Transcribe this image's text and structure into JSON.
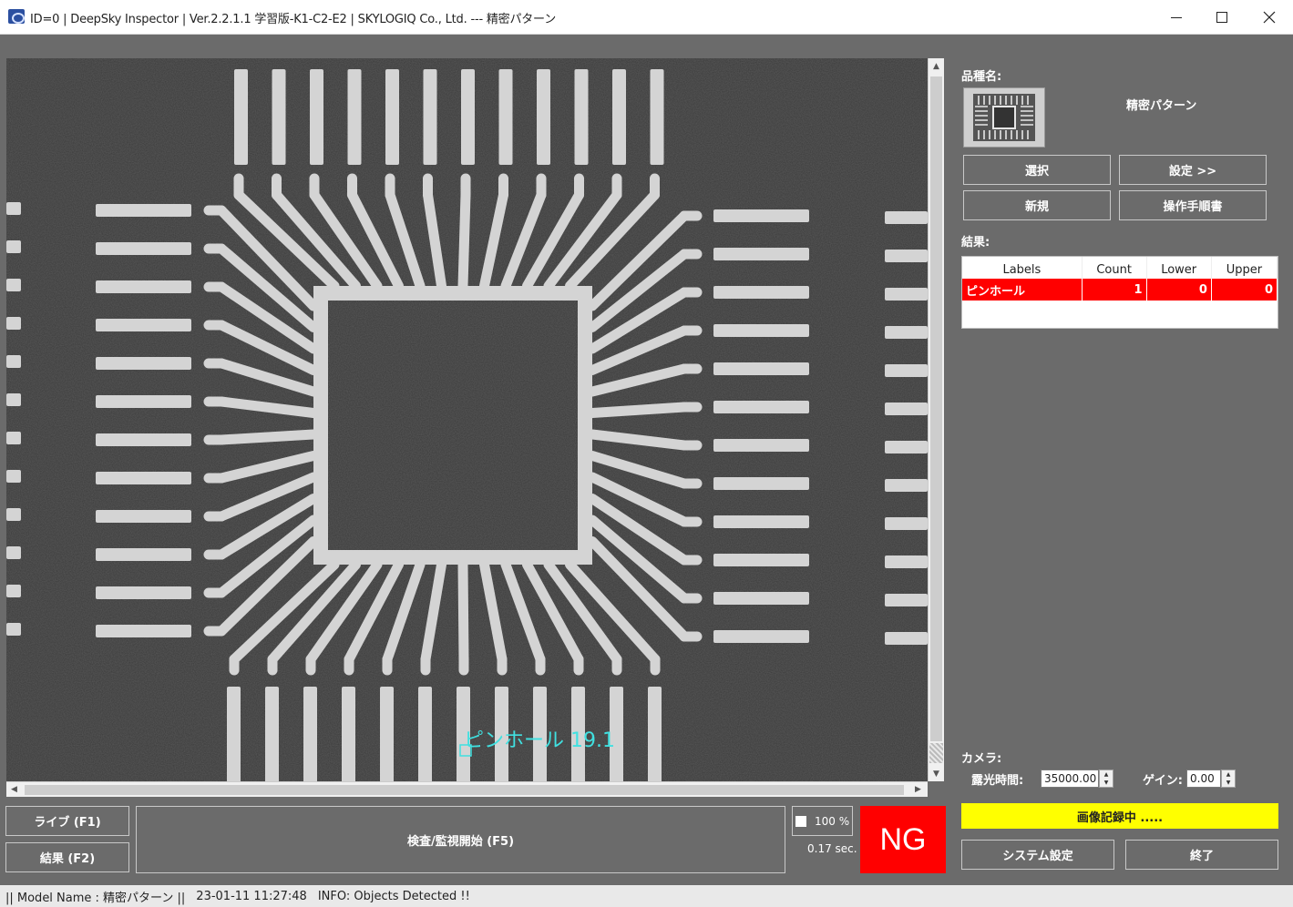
{
  "window": {
    "title": "ID=0 | DeepSky Inspector | Ver.2.2.1.1 学習版-K1-C2-E2 | SKYLOGIQ Co., Ltd. --- 精密パターン",
    "minimize_icon": "minimize-icon",
    "maximize_icon": "maximize-icon",
    "close_icon": "close-icon"
  },
  "viewer": {
    "detection_label": "ピンホール 19.1",
    "detection_color": "#40e0e0"
  },
  "panel": {
    "product_label": "品種名:",
    "model_name": "精密パターン",
    "select_button": "選択",
    "settings_button": "設定 >>",
    "new_button": "新規",
    "manual_button": "操作手順書",
    "results_label": "結果:",
    "results_columns": [
      "Labels",
      "Count",
      "Lower",
      "Upper"
    ],
    "results_rows": [
      {
        "label": "ピンホール",
        "count": "1",
        "lower": "0",
        "upper": "0"
      }
    ],
    "camera_label": "カメラ:",
    "exposure_label": "露光時間:",
    "exposure_value": "35000.00",
    "gain_label": "ゲイン:",
    "gain_value": "0.00",
    "recording_text": "画像記録中 .....",
    "system_settings_button": "システム設定",
    "exit_button": "終了"
  },
  "controls": {
    "live_button": "ライブ (F1)",
    "result_button": "結果 (F2)",
    "inspect_button": "検査/監視開始 (F5)",
    "zoom_text": "100 %",
    "elapsed_time": "0.17 sec.",
    "judgement": "NG"
  },
  "status": {
    "model": "|| Model Name : 精密パターン ||",
    "timestamp": "23-01-11 11:27:48",
    "info": "INFO:   Objects Detected !!"
  },
  "colors": {
    "ng_red": "#ff0000",
    "recording_yellow": "#ffff00",
    "panel_gray": "#6b6b6b"
  }
}
